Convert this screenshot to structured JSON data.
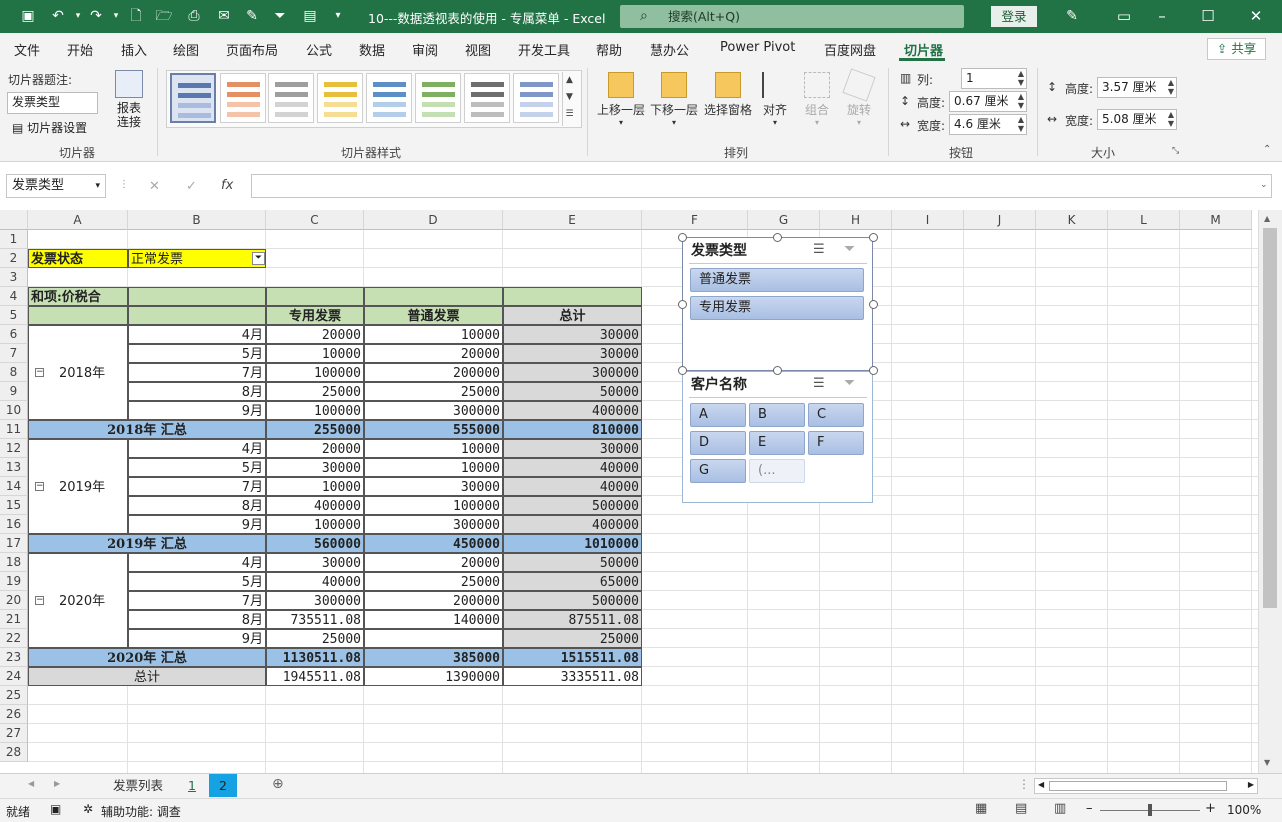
{
  "titlebar": {
    "title": "10---数据透视表的使用 - 专属菜单 - Excel",
    "search": "搜索(Alt+Q)",
    "login": "登录",
    "accent": "#217346"
  },
  "menu": {
    "items": [
      "文件",
      "开始",
      "插入",
      "绘图",
      "页面布局",
      "公式",
      "数据",
      "审阅",
      "视图",
      "开发工具",
      "帮助",
      "慧办公",
      "Power Pivot",
      "百度网盘",
      "切片器"
    ],
    "share": "共享"
  },
  "ribbon": {
    "caption_label": "切片器题注:",
    "caption_value": "发票类型",
    "settings": "切片器设置",
    "report_connections": "报表\n连接",
    "group_slicer": "切片器",
    "group_styles": "切片器样式",
    "bring_forward": "上移一层",
    "send_backward": "下移一层",
    "selection_pane": "选择窗格",
    "align": "对齐",
    "group": "组合",
    "rotate": "旋转",
    "group_arrange": "排列",
    "columns_label": "列:",
    "columns_value": "1",
    "btn_height_label": "高度:",
    "btn_height_value": "0.67 厘米",
    "btn_width_label": "宽度:",
    "btn_width_value": "4.6 厘米",
    "group_buttons": "按钮",
    "size_height_label": "高度:",
    "size_height_value": "3.57 厘米",
    "size_width_label": "宽度:",
    "size_width_value": "5.08 厘米",
    "group_size": "大小"
  },
  "formula": {
    "namebox": "发票类型",
    "cancel": "✕",
    "enter": "✓",
    "fx": "fx",
    "content": ""
  },
  "grid": {
    "columns": [
      "A",
      "B",
      "C",
      "D",
      "E",
      "F",
      "G",
      "H",
      "I",
      "J",
      "K",
      "L",
      "M"
    ],
    "rows": [
      "1",
      "2",
      "3",
      "4",
      "5",
      "6",
      "7",
      "8",
      "9",
      "10",
      "11",
      "12",
      "13",
      "14",
      "15",
      "16",
      "17",
      "18",
      "19",
      "20",
      "21",
      "22",
      "23",
      "24",
      "25",
      "26",
      "27",
      "28"
    ],
    "filter_label": "发票状态",
    "filter_value": "正常发票",
    "value_label": "和项:价税合",
    "col_headers": [
      "专用发票",
      "普通发票",
      "总计"
    ],
    "groups": [
      {
        "year": "2018年",
        "months": [
          "4月",
          "5月",
          "7月",
          "8月",
          "9月"
        ],
        "special": [
          "20000",
          "10000",
          "100000",
          "25000",
          "100000"
        ],
        "normal": [
          "10000",
          "20000",
          "200000",
          "25000",
          "300000"
        ],
        "total": [
          "30000",
          "30000",
          "300000",
          "50000",
          "400000"
        ],
        "subtotal_label": "2018年 汇总",
        "subtotal": [
          "255000",
          "555000",
          "810000"
        ]
      },
      {
        "year": "2019年",
        "months": [
          "4月",
          "5月",
          "7月",
          "8月",
          "9月"
        ],
        "special": [
          "20000",
          "30000",
          "10000",
          "400000",
          "100000"
        ],
        "normal": [
          "10000",
          "10000",
          "30000",
          "100000",
          "300000"
        ],
        "total": [
          "30000",
          "40000",
          "40000",
          "500000",
          "400000"
        ],
        "subtotal_label": "2019年 汇总",
        "subtotal": [
          "560000",
          "450000",
          "1010000"
        ]
      },
      {
        "year": "2020年",
        "months": [
          "4月",
          "5月",
          "7月",
          "8月",
          "9月"
        ],
        "special": [
          "30000",
          "40000",
          "300000",
          "735511.08",
          "25000"
        ],
        "normal": [
          "20000",
          "25000",
          "200000",
          "140000",
          ""
        ],
        "total": [
          "50000",
          "65000",
          "500000",
          "875511.08",
          "25000"
        ],
        "subtotal_label": "2020年 汇总",
        "subtotal": [
          "1130511.08",
          "385000",
          "1515511.08"
        ]
      }
    ],
    "grand_label": "总计",
    "grand": [
      "1945511.08",
      "1390000",
      "3335511.08"
    ]
  },
  "slicers": {
    "invoice_type": {
      "title": "发票类型",
      "items": [
        "普通发票",
        "专用发票"
      ]
    },
    "customer": {
      "title": "客户名称",
      "items": [
        "A",
        "B",
        "C",
        "D",
        "E",
        "F",
        "G",
        "(..."
      ]
    }
  },
  "sheets": {
    "tabs": [
      "发票列表",
      "1",
      "2"
    ],
    "active": "2"
  },
  "status": {
    "ready": "就绪",
    "accessibility": "辅助功能: 调查",
    "zoom": "100%"
  }
}
